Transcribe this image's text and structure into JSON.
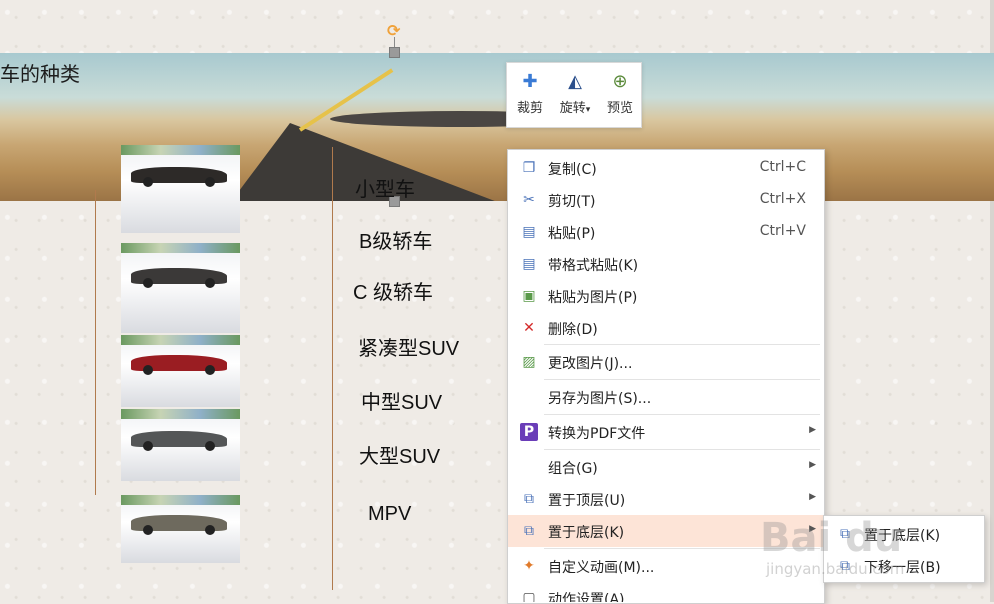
{
  "slide": {
    "banner_title": "车的种类",
    "categories": [
      "小型车",
      "B级轿车",
      "C 级轿车",
      "紧凑型SUV",
      "中型SUV",
      "大型SUV",
      "MPV"
    ],
    "car_colors": [
      "#2d2a28",
      "#3b3938",
      "#9a1d22",
      "#545657",
      "#6e6a5e"
    ]
  },
  "mini_toolbar": {
    "crop": "裁剪",
    "rotate": "旋转",
    "rotate_arrow": "▾",
    "preview": "预览"
  },
  "context_menu": {
    "items": [
      {
        "label": "复制(C)",
        "shortcut": "Ctrl+C",
        "icon": "copy-icon"
      },
      {
        "label": "剪切(T)",
        "shortcut": "Ctrl+X",
        "icon": "scissors-icon"
      },
      {
        "label": "粘贴(P)",
        "shortcut": "Ctrl+V",
        "icon": "paste-icon"
      },
      {
        "label": "带格式粘贴(K)",
        "shortcut": "",
        "icon": "paste-format-icon"
      },
      {
        "label": "粘贴为图片(P)",
        "shortcut": "",
        "icon": "paste-image-icon"
      },
      {
        "label": "删除(D)",
        "shortcut": "",
        "icon": "delete-icon"
      },
      {
        "label": "更改图片(J)...",
        "shortcut": "",
        "icon": "change-picture-icon"
      },
      {
        "label": "另存为图片(S)...",
        "shortcut": "",
        "icon": ""
      },
      {
        "label": "转换为PDF文件",
        "shortcut": "",
        "icon": "pdf-icon"
      },
      {
        "label": "组合(G)",
        "shortcut": "",
        "icon": ""
      },
      {
        "label": "置于顶层(U)",
        "shortcut": "",
        "icon": "bring-front-icon"
      },
      {
        "label": "置于底层(K)",
        "shortcut": "",
        "icon": "send-back-icon"
      },
      {
        "label": "自定义动画(M)...",
        "shortcut": "",
        "icon": "animation-icon"
      },
      {
        "label": "动作设置(A)...",
        "shortcut": "",
        "icon": "action-icon"
      }
    ],
    "highlighted_index": 11,
    "highlight_color": "#fde4d7"
  },
  "submenu": {
    "items": [
      {
        "label": "置于底层(K)",
        "icon": "send-to-back-icon"
      },
      {
        "label": "下移一层(B)",
        "icon": "send-backward-icon"
      }
    ]
  },
  "watermark": {
    "logo": "Bai du",
    "url": "jingyan.baidu.com"
  }
}
